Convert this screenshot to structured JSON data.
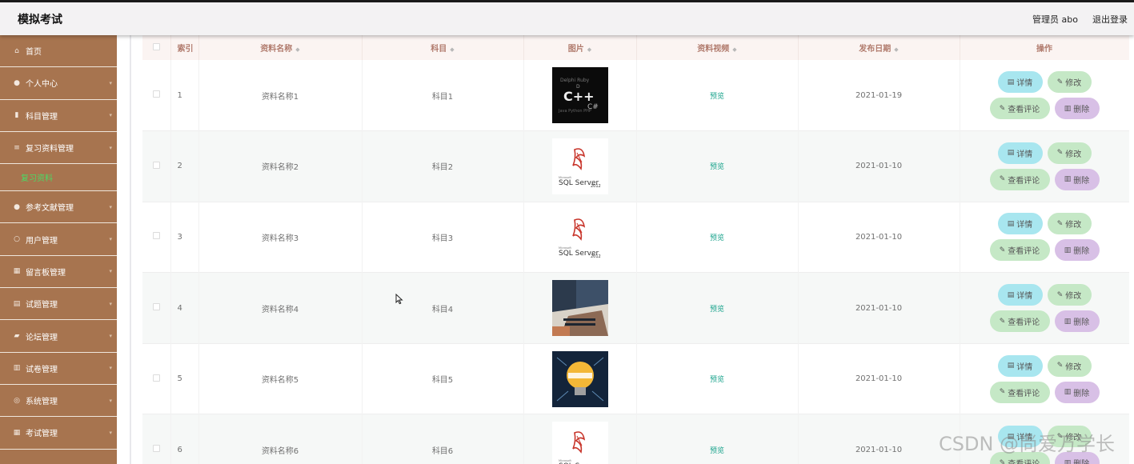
{
  "app": {
    "title": "模拟考试"
  },
  "header": {
    "admin_label": "管理员 abo",
    "logout_label": "退出登录"
  },
  "sidebar": {
    "items": [
      {
        "label": "首页",
        "icon": "home-icon",
        "glyph": "⌂"
      },
      {
        "label": "个人中心",
        "icon": "user-icon",
        "glyph": "●"
      },
      {
        "label": "科目管理",
        "icon": "book-icon",
        "glyph": "▮"
      },
      {
        "label": "复习资料管理",
        "icon": "list-icon",
        "glyph": "≡"
      },
      {
        "label": "复习资料",
        "sub": true
      },
      {
        "label": "参考文献管理",
        "icon": "location-icon",
        "glyph": "●"
      },
      {
        "label": "用户管理",
        "icon": "users-icon",
        "glyph": "○"
      },
      {
        "label": "留言板管理",
        "icon": "grid-icon",
        "glyph": "▦"
      },
      {
        "label": "试题管理",
        "icon": "document-icon",
        "glyph": "▤"
      },
      {
        "label": "论坛管理",
        "icon": "thumb-icon",
        "glyph": "▰"
      },
      {
        "label": "试卷管理",
        "icon": "chart-icon",
        "glyph": "▥"
      },
      {
        "label": "系统管理",
        "icon": "compass-icon",
        "glyph": "◎"
      },
      {
        "label": "考试管理",
        "icon": "apps-icon",
        "glyph": "▦"
      }
    ]
  },
  "table": {
    "headers": {
      "index": "索引",
      "name": "资料名称",
      "subject": "科目",
      "image": "图片",
      "video": "资料视频",
      "date": "发布日期",
      "actions": "操作"
    },
    "rows": [
      {
        "index": "1",
        "name": "资料名称1",
        "subject": "科目1",
        "image": "cpp",
        "video": "预览",
        "date": "2021-01-19"
      },
      {
        "index": "2",
        "name": "资料名称2",
        "subject": "科目2",
        "image": "sql",
        "video": "预览",
        "date": "2021-01-10"
      },
      {
        "index": "3",
        "name": "资料名称3",
        "subject": "科目3",
        "image": "sql",
        "video": "预览",
        "date": "2021-01-10"
      },
      {
        "index": "4",
        "name": "资料名称4",
        "subject": "科目4",
        "image": "laptop",
        "video": "预览",
        "date": "2021-01-10"
      },
      {
        "index": "5",
        "name": "资料名称5",
        "subject": "科目5",
        "image": "bulb",
        "video": "预览",
        "date": "2021-01-10"
      },
      {
        "index": "6",
        "name": "资料名称6",
        "subject": "科目6",
        "image": "sql",
        "video": "预览",
        "date": "2021-01-10"
      }
    ],
    "buttons": {
      "detail": "详情",
      "edit": "修改",
      "comment": "查看评论",
      "delete": "删除"
    }
  },
  "image_text": {
    "cpp": "C++",
    "sql_brand": "SQL Server",
    "sql_ver": "2012",
    "microsoft": "Microsoft"
  },
  "watermark": "CSDN @尚爱万学长",
  "colors": {
    "sidebar": "#a7744f",
    "detail": "#a8e6ef",
    "edit": "#c5e8c6",
    "delete": "#d8c0e6",
    "preview": "#1aa38c"
  }
}
